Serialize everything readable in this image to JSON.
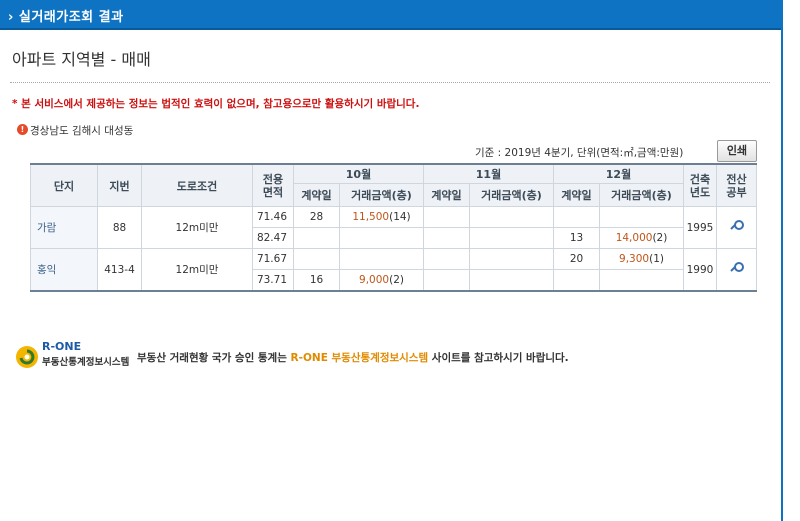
{
  "header": {
    "title": "› 실거래가조회 결과"
  },
  "page_title": "아파트 지역별 - 매매",
  "notice": "* 본 서비스에서 제공하는 정보는 법적인 효력이 없으며, 참고용으로만 활용하시기 바랍니다.",
  "region": {
    "icon": "info-icon",
    "text": "경상남도 김해시 대성동"
  },
  "basis": "기준 : 2019년 4분기, 단위(면적:㎡,금액:만원)",
  "print_label": "인쇄",
  "table": {
    "headers": {
      "complex": "단지",
      "lot": "지번",
      "road": "도로조건",
      "area": "전용\n면적",
      "months": [
        "10월",
        "11월",
        "12월"
      ],
      "contract_day": "계약일",
      "amount": "거래금액(층)",
      "built_year": "건축\n년도",
      "register": "전산\n공부"
    },
    "rows": [
      {
        "complex": "가람",
        "lot": "88",
        "road": "12m미만",
        "built_year": "1995",
        "sub": [
          {
            "area": "71.46",
            "m10_day": "28",
            "m10_amt": "11,500",
            "m10_floor": "(14)",
            "m11_day": "",
            "m11_amt": "",
            "m11_floor": "",
            "m12_day": "",
            "m12_amt": "",
            "m12_floor": ""
          },
          {
            "area": "82.47",
            "m10_day": "",
            "m10_amt": "",
            "m10_floor": "",
            "m11_day": "",
            "m11_amt": "",
            "m11_floor": "",
            "m12_day": "13",
            "m12_amt": "14,000",
            "m12_floor": "(2)"
          }
        ]
      },
      {
        "complex": "홍익",
        "lot": "413-4",
        "road": "12m미만",
        "built_year": "1990",
        "sub": [
          {
            "area": "71.67",
            "m10_day": "",
            "m10_amt": "",
            "m10_floor": "",
            "m11_day": "",
            "m11_amt": "",
            "m11_floor": "",
            "m12_day": "20",
            "m12_amt": "9,300",
            "m12_floor": "(1)"
          },
          {
            "area": "73.71",
            "m10_day": "16",
            "m10_amt": "9,000",
            "m10_floor": "(2)",
            "m11_day": "",
            "m11_amt": "",
            "m11_floor": "",
            "m12_day": "",
            "m12_amt": "",
            "m12_floor": ""
          }
        ]
      }
    ]
  },
  "rone": {
    "logo_name": "R-ONE",
    "logo_sub": "부동산통계정보시스템",
    "text_pre": "부동산 거래현황 국가 승인 통계는 ",
    "text_highlight": "R-ONE 부동산통계정보시스템",
    "text_post": " 사이트를 참고하시기 바랍니다."
  },
  "colors": {
    "header_blue": "#0e73c2",
    "notice_red": "#cc1111",
    "amount_orange": "#c0561a",
    "rone_orange": "#e08a00"
  }
}
